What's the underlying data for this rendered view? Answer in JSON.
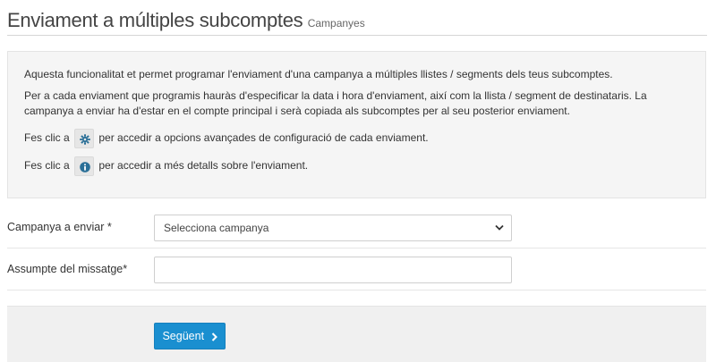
{
  "header": {
    "title": "Enviament a múltiples subcomptes",
    "subtitle": "Campanyes"
  },
  "info": {
    "line1": "Aquesta funcionalitat et permet programar l'enviament d'una campanya a múltiples llistes / segments dels teus subcomptes.",
    "line2": "Per a cada enviament que programis hauràs d'especificar la data i hora d'enviament, així com la llista / segment de destinataris. La campanya a enviar ha d'estar en el compte principal i serà copiada als subcomptes per al seu posterior enviament.",
    "line3_prefix": "Fes clic a",
    "line3_suffix": "per accedir a opcions avançades de configuració de cada enviament.",
    "line3_icon": "gear-icon",
    "line4_prefix": "Fes clic a",
    "line4_suffix": "per accedir a més detalls sobre l'enviament.",
    "line4_icon": "info-icon"
  },
  "form": {
    "campaign_label": "Campanya a enviar *",
    "campaign_selected": "Selecciona campanya",
    "subject_label": "Assumpte del missatge*",
    "subject_value": ""
  },
  "footer": {
    "next_label": "Següent"
  },
  "colors": {
    "accent": "#1a8fd0",
    "icon": "#2a6f97"
  }
}
